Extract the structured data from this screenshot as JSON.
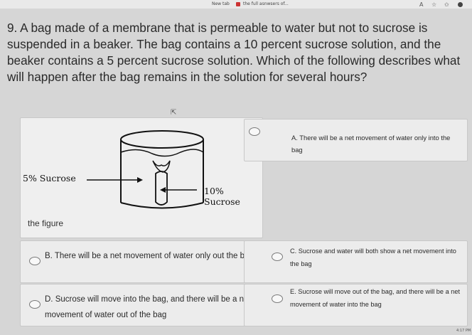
{
  "browser": {
    "new_tab_label": "New tab",
    "active_tab_title": "the full asnwsers of..."
  },
  "question": {
    "text": "9. A bag made of a membrane that is permeable to water but not to sucrose is suspended in a beaker. The bag contains a 10 percent sucrose solution, and the beaker contains a 5 percent sucrose solution. Which of the following describes what will happen after the bag remains in the solution for several hours?"
  },
  "figure": {
    "label_beaker": "5% Sucrose",
    "label_bag": "10% Sucrose",
    "caption": "the figure"
  },
  "options": {
    "a": "A. There will be a net movement of water only into the bag",
    "b": "B. There will be a net movement of water only out the bag",
    "c": "C. Sucrose and water will both show a net movement into the bag",
    "d": "D. Sucrose will move into the bag, and there will be a net movement of water out of the bag",
    "e": "E. Sucrose will move out of the bag, and there will be a net movement of water into the bag"
  },
  "taskbar": {
    "time": "4:17 PM"
  }
}
